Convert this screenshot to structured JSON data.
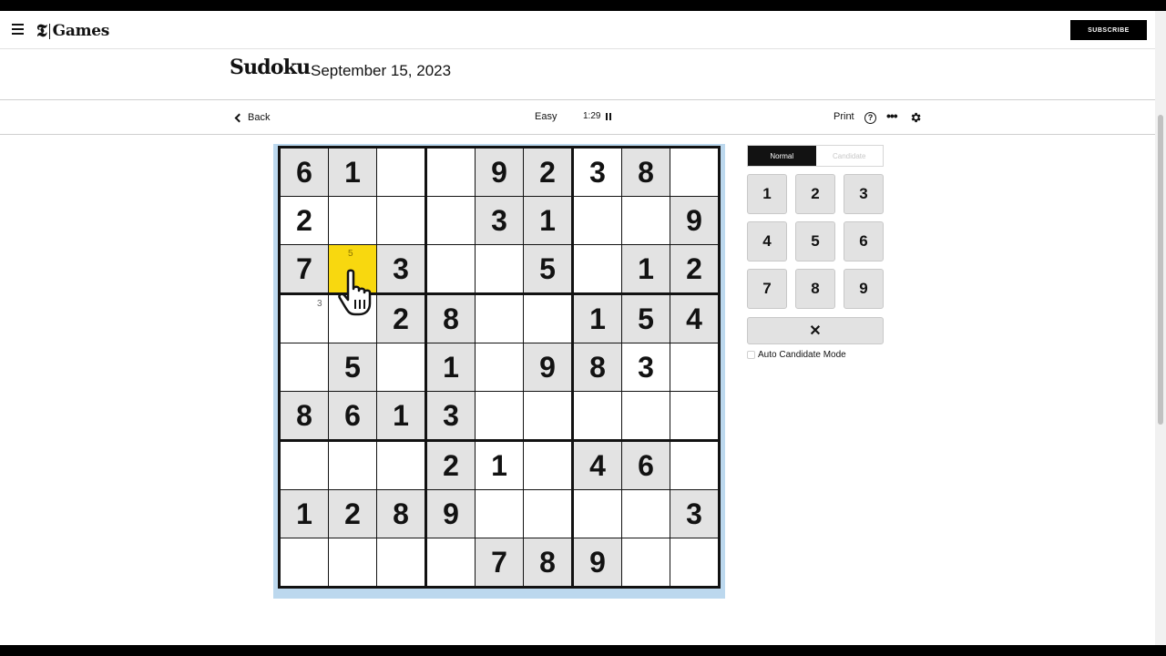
{
  "brand": {
    "logo_mark": "𝕿",
    "logo_text": "Games"
  },
  "header": {
    "subscribe_label": "SUBSCRIBE"
  },
  "game": {
    "title": "Sudoku",
    "date": "September 15, 2023"
  },
  "toolbar": {
    "back_label": "Back",
    "difficulty": "Easy",
    "timer": "1:29",
    "print_label": "Print",
    "help_icon": "?",
    "more_icon": "•••"
  },
  "grid": [
    [
      6,
      1,
      0,
      0,
      9,
      2,
      3,
      8,
      0
    ],
    [
      2,
      0,
      0,
      0,
      3,
      1,
      0,
      0,
      9
    ],
    [
      7,
      0,
      3,
      0,
      0,
      5,
      0,
      1,
      2
    ],
    [
      0,
      0,
      2,
      8,
      0,
      0,
      1,
      5,
      4
    ],
    [
      0,
      5,
      0,
      1,
      0,
      9,
      8,
      3,
      0
    ],
    [
      8,
      6,
      1,
      3,
      0,
      0,
      0,
      0,
      0
    ],
    [
      0,
      0,
      0,
      2,
      1,
      0,
      4,
      6,
      0
    ],
    [
      1,
      2,
      8,
      9,
      0,
      0,
      0,
      0,
      3
    ],
    [
      0,
      0,
      0,
      0,
      7,
      8,
      9,
      0,
      0
    ]
  ],
  "givens": [
    [
      1,
      1,
      0,
      0,
      1,
      1,
      0,
      1,
      0
    ],
    [
      0,
      0,
      0,
      0,
      1,
      1,
      0,
      0,
      1
    ],
    [
      1,
      0,
      1,
      0,
      0,
      1,
      0,
      1,
      1
    ],
    [
      0,
      0,
      1,
      1,
      0,
      0,
      1,
      1,
      1
    ],
    [
      0,
      1,
      0,
      1,
      0,
      1,
      1,
      0,
      0
    ],
    [
      1,
      1,
      1,
      1,
      0,
      0,
      0,
      0,
      0
    ],
    [
      0,
      0,
      0,
      1,
      0,
      0,
      1,
      1,
      0
    ],
    [
      1,
      1,
      1,
      1,
      0,
      0,
      0,
      0,
      1
    ],
    [
      0,
      0,
      0,
      0,
      1,
      1,
      1,
      0,
      0
    ]
  ],
  "selected_cell": {
    "row": 2,
    "col": 1,
    "candidate": "5"
  },
  "candidates": [
    {
      "row": 3,
      "col": 0,
      "value": "3"
    }
  ],
  "controls": {
    "mode_normal": "Normal",
    "mode_candidate": "Candidate",
    "numbers": [
      "1",
      "2",
      "3",
      "4",
      "5",
      "6",
      "7",
      "8",
      "9"
    ],
    "erase_label": "✕",
    "auto_candidate_label": "Auto Candidate Mode"
  },
  "colors": {
    "selected": "#f8d80f",
    "given_bg": "#e3e3e3",
    "board_highlight": "#bcd8ee"
  },
  "icons": [
    "menu-icon",
    "back-chevron-icon",
    "pause-icon",
    "help-icon",
    "more-icon",
    "gear-icon",
    "hand-cursor-icon"
  ]
}
